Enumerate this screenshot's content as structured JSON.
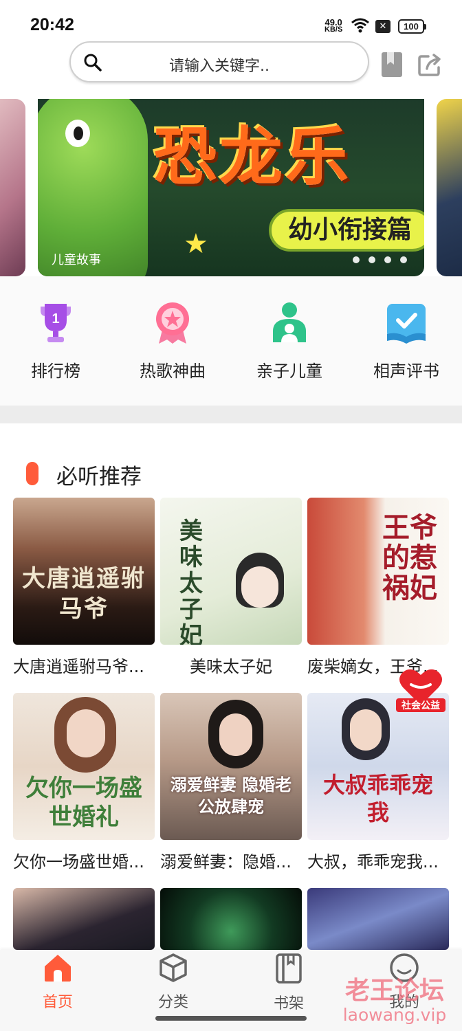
{
  "status_bar": {
    "time": "20:42",
    "net_speed": "49.0",
    "net_unit": "KB/S",
    "battery": "100"
  },
  "search": {
    "placeholder": "请输入关键字.."
  },
  "banner": {
    "title": "恐龙乐",
    "subtitle": "幼小衔接篇",
    "category_tag": "儿童故事",
    "slide_count": 4
  },
  "quick_menu": [
    {
      "label": "排行榜",
      "icon": "trophy-icon"
    },
    {
      "label": "热歌神曲",
      "icon": "medal-icon"
    },
    {
      "label": "亲子儿童",
      "icon": "parent-child-icon"
    },
    {
      "label": "相声评书",
      "icon": "book-check-icon"
    }
  ],
  "recommend": {
    "title": "必听推荐",
    "books": [
      {
        "title": "大唐逍遥驸马爷...",
        "cover_text": "大唐逍遥驸马爷"
      },
      {
        "title": "美味太子妃",
        "cover_text": "美味太子妃"
      },
      {
        "title": "废柴嫡女，王爷...",
        "cover_text": "王爷的惹祸妃"
      },
      {
        "title": "欠你一场盛世婚...",
        "cover_text": "欠你一场盛世婚礼"
      },
      {
        "title": "溺爱鲜妻：隐婚...",
        "cover_text": "溺爱鲜妻 隐婚老公放肆宠"
      },
      {
        "title": "大叔，乖乖宠我...",
        "cover_text": "大叔乖乖宠我"
      }
    ],
    "badge_label": "社会公益"
  },
  "bottom_nav": [
    {
      "label": "首页",
      "icon": "home-icon",
      "active": true
    },
    {
      "label": "分类",
      "icon": "cube-icon",
      "active": false
    },
    {
      "label": "书架",
      "icon": "bookshelf-icon",
      "active": false
    },
    {
      "label": "我的",
      "icon": "profile-icon",
      "active": false
    }
  ],
  "watermark": {
    "line1": "老王论坛",
    "line2": "laowang.vip"
  },
  "colors": {
    "accent": "#ff5b3a",
    "search_border": "#cfcfcf",
    "section_gap": "#ececec"
  }
}
